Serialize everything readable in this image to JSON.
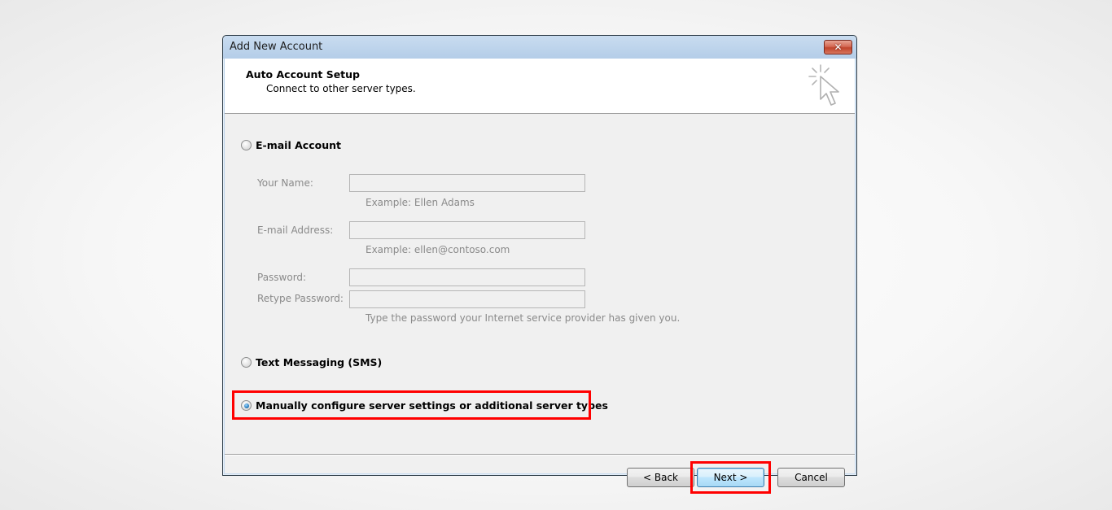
{
  "window": {
    "title": "Add New Account",
    "close_icon": "close-icon"
  },
  "header": {
    "title": "Auto Account Setup",
    "subtitle": "Connect to other server types.",
    "icon": "cursor-click-icon"
  },
  "options": {
    "email_account": {
      "label": "E-mail Account",
      "selected": false
    },
    "text_messaging": {
      "label": "Text Messaging (SMS)",
      "selected": false
    },
    "manual_configure": {
      "label": "Manually configure server settings or additional server types",
      "selected": true
    }
  },
  "fields": {
    "your_name": {
      "label": "Your Name:",
      "value": "",
      "hint": "Example: Ellen Adams"
    },
    "email_address": {
      "label": "E-mail Address:",
      "value": "",
      "hint": "Example: ellen@contoso.com"
    },
    "password": {
      "label": "Password:",
      "value": ""
    },
    "retype_password": {
      "label": "Retype Password:",
      "value": ""
    },
    "password_hint": "Type the password your Internet service provider has given you."
  },
  "buttons": {
    "back": "< Back",
    "next": "Next >",
    "cancel": "Cancel"
  },
  "annotations": {
    "highlight_color": "#ff0000"
  }
}
